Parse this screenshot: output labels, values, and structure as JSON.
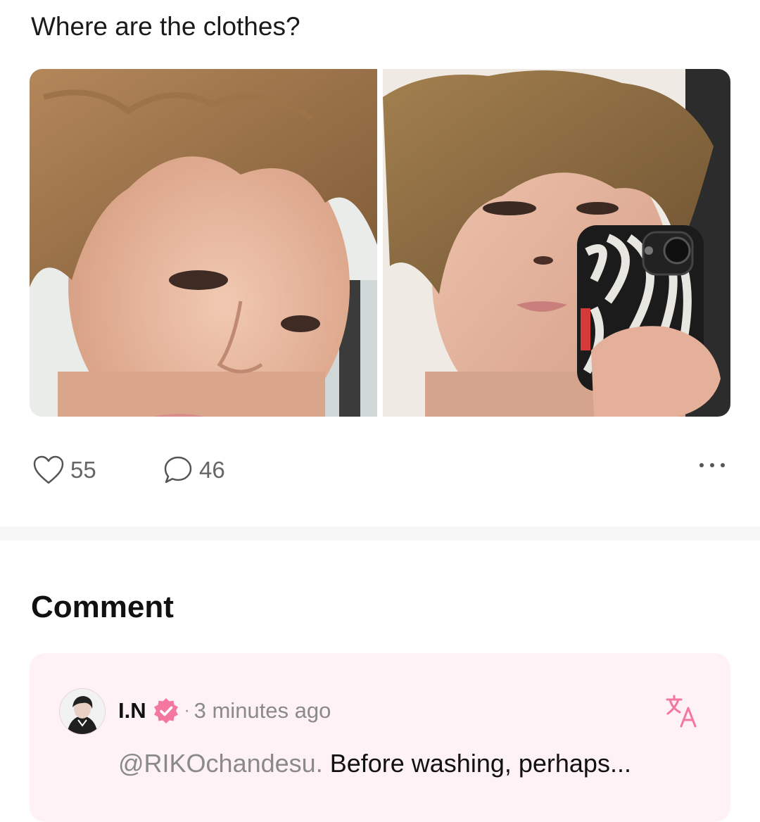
{
  "post": {
    "text": "Where are the clothes?",
    "photos": [
      {
        "icon": "selfie-photo-closeup"
      },
      {
        "icon": "mirror-selfie-zebra-phone"
      }
    ],
    "likes": "55",
    "comments": "46",
    "icons": {
      "like": "heart-icon",
      "comment": "comment-bubble-icon",
      "more": "more-dots-icon"
    }
  },
  "comments_section": {
    "title": "Comment",
    "items": [
      {
        "username": "I.N",
        "verified": true,
        "separator": "·",
        "time": "3 minutes ago",
        "mention": "@RIKOchandesu.",
        "text": " Before washing, perhaps..."
      }
    ]
  },
  "colors": {
    "accent": "#f3779f",
    "card_bg": "#fff2f6",
    "muted": "#8a8a8a"
  }
}
